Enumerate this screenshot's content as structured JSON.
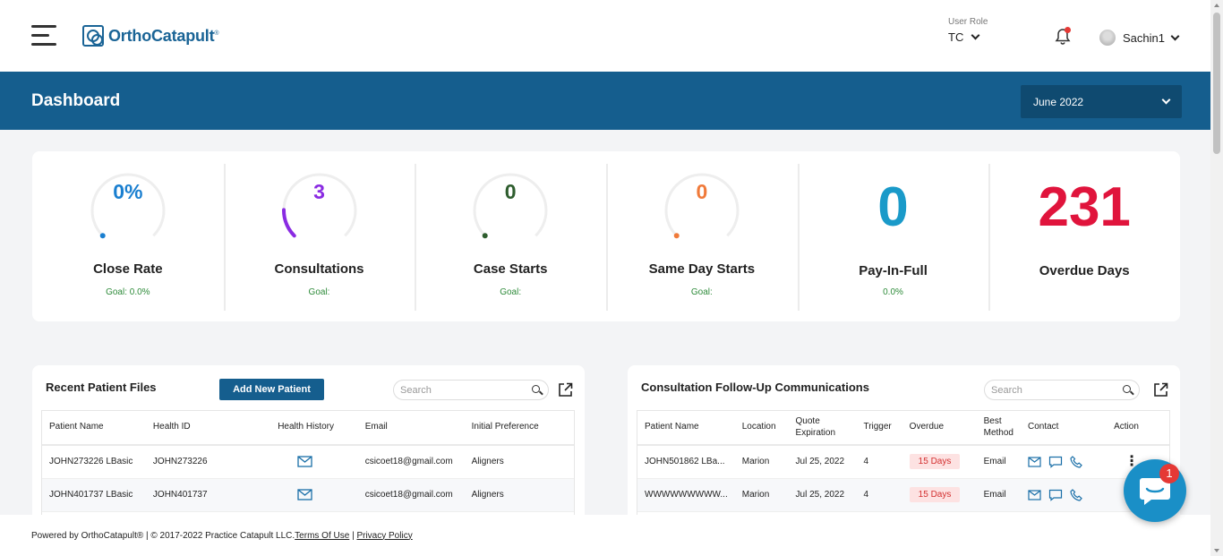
{
  "header": {
    "logo_text": "OrthoCatapult",
    "logo_reg": "®",
    "user_role_label": "User Role",
    "user_role_value": "TC",
    "username": "Sachin1"
  },
  "titlebar": {
    "title": "Dashboard",
    "month": "June 2022"
  },
  "kpis": [
    {
      "value": "0%",
      "name": "Close Rate",
      "goal": "Goal: 0.0%",
      "color": "#1a7fd0",
      "arc_fraction": 0.0
    },
    {
      "value": "3",
      "name": "Consultations",
      "goal": "Goal:",
      "color": "#8a2be2",
      "arc_fraction": 0.17
    },
    {
      "value": "0",
      "name": "Case Starts",
      "goal": "Goal:",
      "color": "#2e5d2e",
      "arc_fraction": 0.0
    },
    {
      "value": "0",
      "name": "Same Day Starts",
      "goal": "Goal:",
      "color": "#f07a3a",
      "arc_fraction": 0.0
    },
    {
      "value": "0",
      "name": "Pay-In-Full",
      "goal": "0.0%",
      "color": "#1a9ac9"
    },
    {
      "value": "231",
      "name": "Overdue Days",
      "goal": "",
      "color": "#e0143c"
    }
  ],
  "recent_patients": {
    "title": "Recent Patient Files",
    "add_button": "Add New Patient",
    "search_placeholder": "Search",
    "columns": [
      "Patient Name",
      "Health ID",
      "Health History",
      "Email",
      "Initial Preference"
    ],
    "rows": [
      {
        "name": "JOHN273226 LBasic",
        "health_id": "JOHN273226",
        "email": "csicoet18@gmail.com",
        "preference": "Aligners"
      },
      {
        "name": "JOHN401737 LBasic",
        "health_id": "JOHN401737",
        "email": "csicoet18@gmail.com",
        "preference": "Aligners"
      }
    ]
  },
  "followups": {
    "title": "Consultation Follow-Up Communications",
    "search_placeholder": "Search",
    "columns": [
      "Patient Name",
      "Location",
      "Quote Expiration",
      "Trigger",
      "Overdue",
      "Best Method",
      "Contact",
      "Action"
    ],
    "rows": [
      {
        "name": "JOHN501862 LBa...",
        "location": "Marion",
        "expiration": "Jul 25, 2022",
        "trigger": "4",
        "overdue": "15 Days",
        "method": "Email"
      },
      {
        "name": "WWWWWWWWW...",
        "location": "Marion",
        "expiration": "Jul 25, 2022",
        "trigger": "4",
        "overdue": "15 Days",
        "method": "Email"
      }
    ]
  },
  "footer": {
    "text": "Powered by OrthoCatapult® | © 2017-2022 Practice Catapult LLC. ",
    "terms": "Terms Of Use",
    "sep": " | ",
    "privacy": "Privacy Policy"
  },
  "chat": {
    "badge": "1"
  }
}
